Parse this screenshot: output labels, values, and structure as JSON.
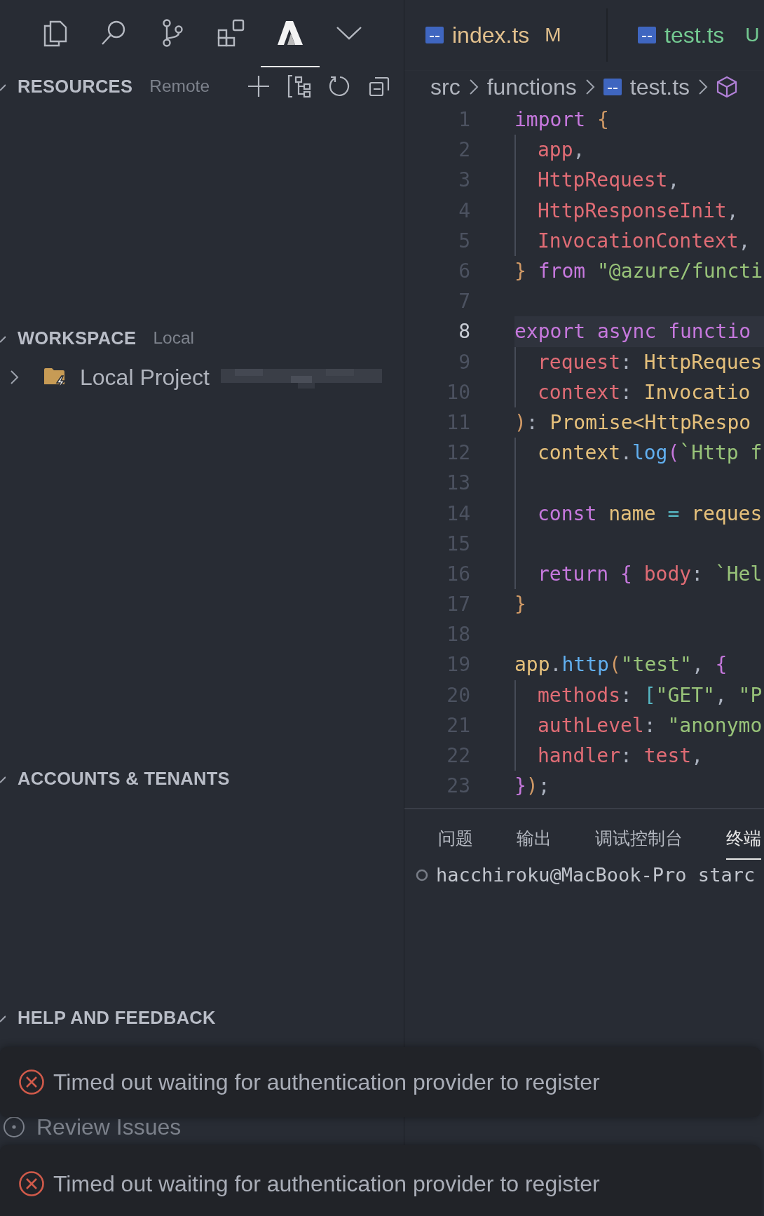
{
  "activity_bar": [
    {
      "kind": "explorer",
      "selected": false
    },
    {
      "kind": "search",
      "selected": false
    },
    {
      "kind": "source-control",
      "selected": false
    },
    {
      "kind": "extensions",
      "selected": false
    },
    {
      "kind": "azure",
      "selected": true
    },
    {
      "kind": "more",
      "selected": false
    }
  ],
  "sidebar": {
    "sections": [
      {
        "kind": "resources",
        "title": "RESOURCES",
        "subtitle": "Remote",
        "expanded": true
      },
      {
        "kind": "workspace",
        "title": "WORKSPACE",
        "subtitle": "Local",
        "expanded": true,
        "items": [
          {
            "kind": "project",
            "label": "Local Project",
            "expanded": false
          }
        ]
      },
      {
        "kind": "accounts",
        "title": "ACCOUNTS & TENANTS",
        "expanded": true
      },
      {
        "kind": "help",
        "title": "HELP AND FEEDBACK",
        "expanded": true,
        "items": [
          {
            "kind": "link",
            "label": "Review Issues"
          }
        ]
      }
    ]
  },
  "editor_tabs": [
    {
      "label": "index.ts",
      "status": "M",
      "kind": "modified"
    },
    {
      "label": "test.ts",
      "status": "U",
      "kind": "untracked"
    }
  ],
  "breadcrumb": [
    "src",
    "functions",
    "test.ts"
  ],
  "code": {
    "lines": [
      {
        "number": "1",
        "indented": false,
        "current": false,
        "tokens": [
          {
            "text": "import",
            "kind": "keyword"
          },
          {
            "text": " {",
            "kind": "bracket1"
          }
        ]
      },
      {
        "number": "2",
        "indented": true,
        "current": false,
        "tokens": [
          {
            "text": "app",
            "kind": "variable"
          },
          {
            "text": ",",
            "kind": "punct"
          }
        ]
      },
      {
        "number": "3",
        "indented": true,
        "current": false,
        "tokens": [
          {
            "text": "HttpRequest",
            "kind": "variable"
          },
          {
            "text": ",",
            "kind": "punct"
          }
        ]
      },
      {
        "number": "4",
        "indented": true,
        "current": false,
        "tokens": [
          {
            "text": "HttpResponseInit",
            "kind": "variable"
          },
          {
            "text": ",",
            "kind": "punct"
          }
        ]
      },
      {
        "number": "5",
        "indented": true,
        "current": false,
        "tokens": [
          {
            "text": "InvocationContext",
            "kind": "variable"
          },
          {
            "text": ",",
            "kind": "punct"
          }
        ]
      },
      {
        "number": "6",
        "indented": false,
        "current": false,
        "tokens": [
          {
            "text": "}",
            "kind": "bracket1"
          },
          {
            "text": " from",
            "kind": "keyword"
          },
          {
            "text": " \"@azure/functi",
            "kind": "string"
          }
        ]
      },
      {
        "number": "7",
        "indented": false,
        "current": false
      },
      {
        "number": "8",
        "indented": false,
        "current": true,
        "tokens": [
          {
            "text": "export async functio",
            "kind": "keyword"
          }
        ]
      },
      {
        "number": "9",
        "indented": true,
        "current": false,
        "tokens": [
          {
            "text": "request",
            "kind": "variable"
          },
          {
            "text": ": ",
            "kind": "punct"
          },
          {
            "text": "HttpReques",
            "kind": "type"
          }
        ]
      },
      {
        "number": "10",
        "indented": true,
        "current": false,
        "tokens": [
          {
            "text": "context",
            "kind": "variable"
          },
          {
            "text": ": ",
            "kind": "punct"
          },
          {
            "text": "Invocatio",
            "kind": "type"
          }
        ]
      },
      {
        "number": "11",
        "indented": false,
        "current": false,
        "tokens": [
          {
            "text": ")",
            "kind": "bracket1"
          },
          {
            "text": ": ",
            "kind": "punct"
          },
          {
            "text": "Promise<HttpRespo",
            "kind": "type"
          }
        ]
      },
      {
        "number": "12",
        "indented": true,
        "current": false,
        "tokens": [
          {
            "text": "context",
            "kind": "type"
          },
          {
            "text": ".",
            "kind": "punct"
          },
          {
            "text": "log",
            "kind": "function"
          },
          {
            "text": "(",
            "kind": "bracket2"
          },
          {
            "text": "`Http f",
            "kind": "string"
          }
        ]
      },
      {
        "number": "13",
        "indented": true,
        "current": false
      },
      {
        "number": "14",
        "indented": true,
        "current": false,
        "tokens": [
          {
            "text": "const",
            "kind": "keyword"
          },
          {
            "text": " name",
            "kind": "type"
          },
          {
            "text": " =",
            "kind": "operator"
          },
          {
            "text": " reques",
            "kind": "type"
          }
        ]
      },
      {
        "number": "15",
        "indented": true,
        "current": false
      },
      {
        "number": "16",
        "indented": true,
        "current": false,
        "tokens": [
          {
            "text": "return",
            "kind": "keyword"
          },
          {
            "text": " {",
            "kind": "bracket2"
          },
          {
            "text": " body",
            "kind": "variable"
          },
          {
            "text": ": ",
            "kind": "punct"
          },
          {
            "text": "`Hel",
            "kind": "string"
          }
        ]
      },
      {
        "number": "17",
        "indented": false,
        "current": false,
        "tokens": [
          {
            "text": "}",
            "kind": "bracket1"
          }
        ]
      },
      {
        "number": "18",
        "indented": false,
        "current": false
      },
      {
        "number": "19",
        "indented": false,
        "current": false,
        "tokens": [
          {
            "text": "app",
            "kind": "type"
          },
          {
            "text": ".",
            "kind": "punct"
          },
          {
            "text": "http",
            "kind": "function"
          },
          {
            "text": "(",
            "kind": "bracket1"
          },
          {
            "text": "\"test\"",
            "kind": "string"
          },
          {
            "text": ", ",
            "kind": "punct"
          },
          {
            "text": "{",
            "kind": "bracket2"
          }
        ]
      },
      {
        "number": "20",
        "indented": true,
        "current": false,
        "tokens": [
          {
            "text": "methods",
            "kind": "variable"
          },
          {
            "text": ": ",
            "kind": "punct"
          },
          {
            "text": "[",
            "kind": "operator"
          },
          {
            "text": "\"GET\"",
            "kind": "string"
          },
          {
            "text": ", ",
            "kind": "punct"
          },
          {
            "text": "\"P",
            "kind": "string"
          }
        ]
      },
      {
        "number": "21",
        "indented": true,
        "current": false,
        "tokens": [
          {
            "text": "authLevel",
            "kind": "variable"
          },
          {
            "text": ": ",
            "kind": "punct"
          },
          {
            "text": "\"anonymo",
            "kind": "string"
          }
        ]
      },
      {
        "number": "22",
        "indented": true,
        "current": false,
        "tokens": [
          {
            "text": "handler",
            "kind": "variable"
          },
          {
            "text": ": ",
            "kind": "punct"
          },
          {
            "text": "test",
            "kind": "variable"
          },
          {
            "text": ",",
            "kind": "punct"
          }
        ]
      },
      {
        "number": "23",
        "indented": false,
        "current": false,
        "tokens": [
          {
            "text": "}",
            "kind": "bracket2"
          },
          {
            "text": ")",
            "kind": "bracket1"
          },
          {
            "text": ";",
            "kind": "punct"
          }
        ]
      }
    ]
  },
  "panel": {
    "tabs": [
      {
        "label": "问题",
        "selected": false
      },
      {
        "label": "输出",
        "selected": false
      },
      {
        "label": "调试控制台",
        "selected": false
      },
      {
        "label": "终端",
        "selected": true
      }
    ],
    "terminal_line": "hacchiroku@MacBook-Pro starc"
  },
  "notifications": [
    {
      "kind": "error",
      "message": "Timed out waiting for authentication provider to register"
    },
    {
      "kind": "error",
      "message": "Timed out waiting for authentication provider to register"
    }
  ]
}
